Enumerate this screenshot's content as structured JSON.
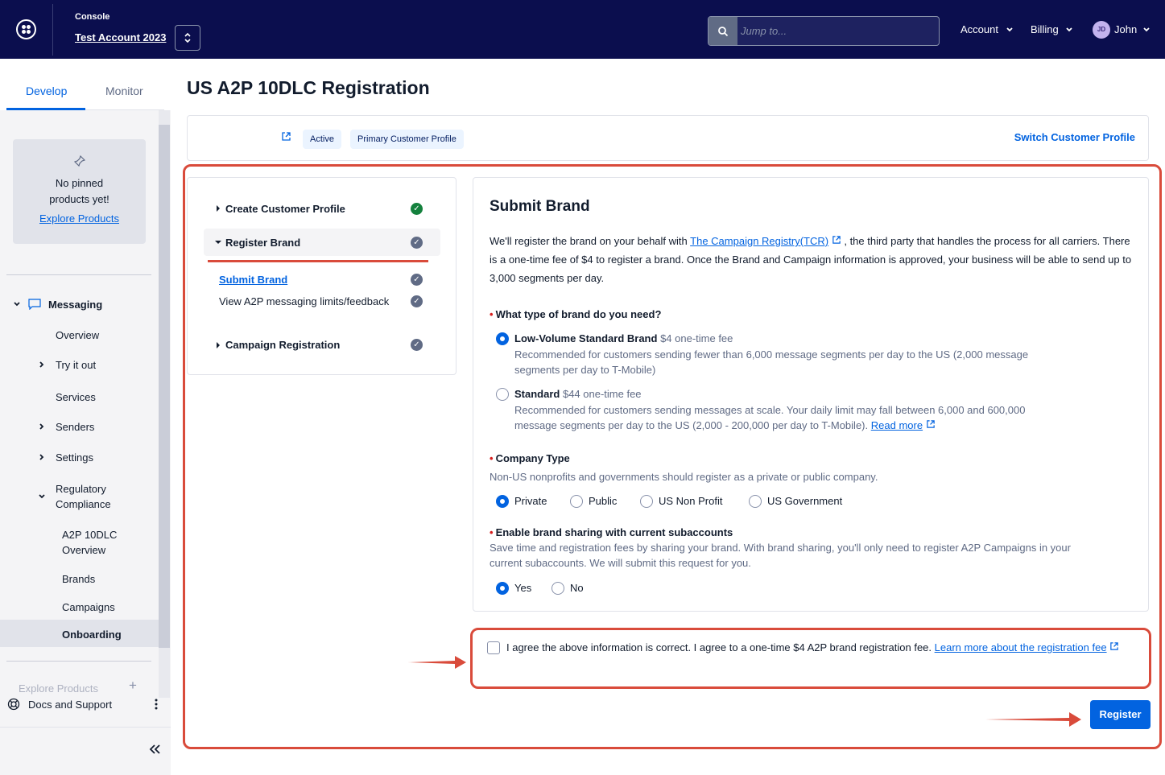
{
  "header": {
    "console_label": "Console",
    "account_name": "Test Account 2023",
    "search_placeholder": "Jump to...",
    "account_menu": "Account",
    "billing_menu": "Billing",
    "user_initials": "JD",
    "user_name": "John"
  },
  "sidebar": {
    "tabs": [
      "Develop",
      "Monitor"
    ],
    "pinned_empty_text": "No pinned products yet!",
    "explore_link": "Explore Products",
    "section": "Messaging",
    "items": {
      "overview": "Overview",
      "try_it_out": "Try it out",
      "services": "Services",
      "senders": "Senders",
      "settings": "Settings",
      "regulatory_compliance": "Regulatory Compliance",
      "a2p_overview": "A2P 10DLC Overview",
      "brands": "Brands",
      "campaigns": "Campaigns",
      "onboarding": "Onboarding"
    },
    "explore_products_footer": "Explore Products",
    "docs_support": "Docs and Support"
  },
  "main": {
    "page_title": "US A2P 10DLC Registration",
    "profile_bar": {
      "status_badge": "Active",
      "profile_badge": "Primary Customer Profile",
      "switch_link": "Switch Customer Profile"
    },
    "steps": {
      "create_profile": "Create Customer Profile",
      "register_brand": "Register Brand",
      "submit_brand": "Submit Brand",
      "view_limits": "View A2P messaging limits/feedback",
      "campaign_registration": "Campaign Registration"
    },
    "form": {
      "title": "Submit Brand",
      "intro_1": "We'll register the brand on your behalf with",
      "intro_link": "The Campaign Registry(TCR)",
      "intro_2": ", the third party that handles the process for all carriers. There is a one-time fee of $4 to register a brand. Once the Brand and Campaign information is approved, your business will be able to send up to 3,000 segments per day.",
      "brand_type_question": "What type of brand do you need?",
      "low_volume_label": "Low-Volume Standard Brand",
      "low_volume_fee": "$4 one-time fee",
      "low_volume_desc": "Recommended for customers sending fewer than 6,000 message segments per day to the US (2,000 message segments per day to T-Mobile)",
      "standard_label": "Standard",
      "standard_fee": "$44 one-time fee",
      "standard_desc": "Recommended for customers sending messages at scale. Your daily limit may fall between 6,000 and 600,000 message segments per day to the US (2,000 - 200,000 per day to T-Mobile).",
      "read_more": "Read more",
      "company_type_label": "Company Type",
      "company_type_help": "Non-US nonprofits and governments should register as a private or public company.",
      "company_options": [
        "Private",
        "Public",
        "US Non Profit",
        "US Government"
      ],
      "sharing_label": "Enable brand sharing with current subaccounts",
      "sharing_help": "Save time and registration fees by sharing your brand. With brand sharing, you'll only need to register A2P Campaigns in your current subaccounts. We will submit this request for you.",
      "sharing_options": [
        "Yes",
        "No"
      ]
    },
    "agreement_text": "I agree the above information is correct. I agree to a one-time $4 A2P brand registration fee.",
    "agreement_link": "Learn more about the registration fee",
    "register_button": "Register"
  }
}
